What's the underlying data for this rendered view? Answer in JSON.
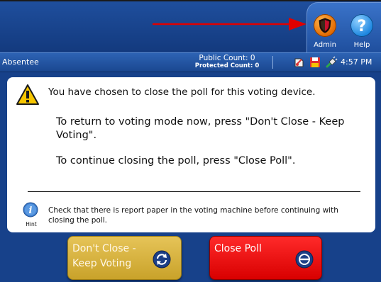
{
  "topbar": {
    "tabs": [
      {
        "label": "Admin",
        "icon": "shield-icon"
      },
      {
        "label": "Help",
        "icon": "question-mark-icon"
      }
    ]
  },
  "statusbar": {
    "mode": "Absentee",
    "public_count": "Public Count: 0",
    "protected_count": "Protected Count: 0",
    "time": "4:57 PM",
    "icons": [
      "report-icon",
      "save-disk-icon",
      "power-plug-icon"
    ]
  },
  "dialog": {
    "message": "You have chosen to close the poll for this voting device.",
    "return_instruction": "To return to voting mode now, press \"Don't Close - Keep Voting\".",
    "continue_instruction": "To continue closing the poll, press \"Close Poll\".",
    "hint_caption": "Hint",
    "hint_text": "Check that there is report paper in the voting machine before continuing with closing the poll."
  },
  "buttons": {
    "keep_voting_line1": "Don't Close -",
    "keep_voting_line2": "Keep Voting",
    "close_poll": "Close Poll"
  },
  "colors": {
    "background": "#17418a",
    "keep_button": "#d9b445",
    "close_button": "#f00000",
    "annotation_arrow": "#e00000"
  }
}
